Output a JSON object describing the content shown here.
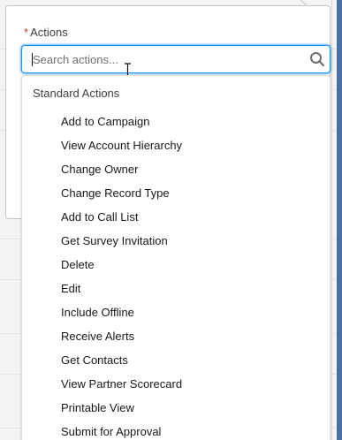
{
  "field": {
    "required_mark": "*",
    "label": "Actions"
  },
  "search": {
    "placeholder": "Search actions...",
    "value": ""
  },
  "dropdown": {
    "group_header": "Standard Actions",
    "options": [
      "Add to Campaign",
      "View Account Hierarchy",
      "Change Owner",
      "Change Record Type",
      "Add to Call List",
      "Get Survey Invitation",
      "Delete",
      "Edit",
      "Include Offline",
      "Receive Alerts",
      "Get Contacts",
      "View Partner Scorecard",
      "Printable View",
      "Submit for Approval"
    ]
  },
  "colors": {
    "focus_border": "#1b96ff",
    "required": "#c23934",
    "side_strip": "#4a6fa5"
  },
  "icons": {
    "search": "search-icon",
    "text_cursor": "ibeam-cursor-icon"
  }
}
